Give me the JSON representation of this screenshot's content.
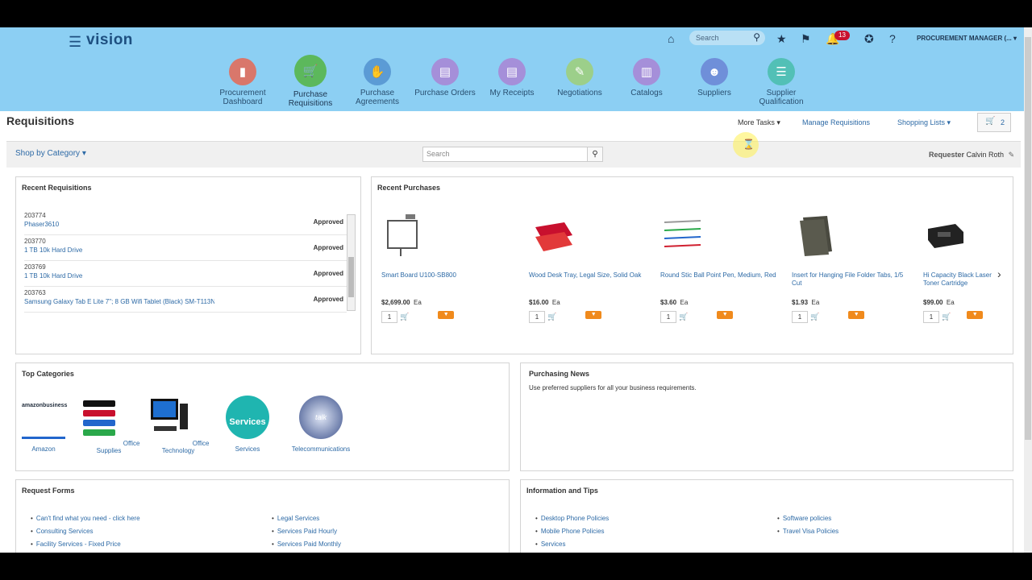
{
  "header": {
    "logo": "vision",
    "search_placeholder": "Search",
    "notifications_count": "13",
    "user": "PROCUREMENT MANAGER (...",
    "colors": {
      "bar": "#8ccff3",
      "badge": "#c8102e"
    }
  },
  "nav": [
    {
      "label": "Procurement Dashboard",
      "color": "#d9776b",
      "icon": "chart-icon"
    },
    {
      "label": "Purchase Requisitions",
      "color": "#5cb85c",
      "icon": "cart-icon"
    },
    {
      "label": "Purchase Agreements",
      "color": "#5b9bd5",
      "icon": "handshake-icon"
    },
    {
      "label": "Purchase Orders",
      "color": "#a58fd9",
      "icon": "document-icon"
    },
    {
      "label": "My Receipts",
      "color": "#a58fd9",
      "icon": "receipt-icon"
    },
    {
      "label": "Negotiations",
      "color": "#9ccf8a",
      "icon": "negotiation-icon"
    },
    {
      "label": "Catalogs",
      "color": "#a58fd9",
      "icon": "catalog-icon"
    },
    {
      "label": "Suppliers",
      "color": "#6f8fd9",
      "icon": "people-icon"
    },
    {
      "label": "Supplier Qualification",
      "color": "#52c0b6",
      "icon": "checklist-icon"
    }
  ],
  "page": {
    "title": "Requisitions",
    "more_tasks": "More Tasks",
    "manage": "Manage Requisitions",
    "shopping_lists": "Shopping Lists",
    "cart_count": "2"
  },
  "toolbar": {
    "shop_by_category": "Shop by Category",
    "search_placeholder": "Search",
    "requester_label": "Requester",
    "requester_value": "Calvin Roth"
  },
  "recent_requisitions": {
    "title": "Recent Requisitions",
    "items": [
      {
        "num": "203774",
        "desc": "Phaser3610",
        "status": "Approved"
      },
      {
        "num": "203770",
        "desc": "1 TB 10k Hard Drive",
        "status": "Approved"
      },
      {
        "num": "203769",
        "desc": "1 TB 10k Hard Drive",
        "status": "Approved"
      },
      {
        "num": "203763",
        "desc": "Samsung Galaxy Tab E Lite 7\"; 8 GB Wifi Tablet (Black) SM-T113N",
        "status": "Approved"
      }
    ]
  },
  "recent_purchases": {
    "title": "Recent Purchases",
    "items": [
      {
        "name": "Smart Board U100-SB800",
        "price": "$2,699.00",
        "uom": "Ea",
        "qty": "1"
      },
      {
        "name": "Wood Desk Tray, Legal Size, Solid Oak",
        "price": "$16.00",
        "uom": "Ea",
        "qty": "1"
      },
      {
        "name": "Round Stic Ball Point Pen, Medium, Red",
        "price": "$3.60",
        "uom": "Ea",
        "qty": "1"
      },
      {
        "name": "Insert for Hanging File Folder Tabs, 1/5 Cut",
        "price": "$1.93",
        "uom": "Ea",
        "qty": "1"
      },
      {
        "name": "Hi Capacity Black Laser Toner Cartridge",
        "price": "$99.00",
        "uom": "Ea",
        "qty": "1"
      }
    ]
  },
  "top_categories": {
    "title": "Top Categories",
    "items": [
      {
        "label": "Amazon",
        "img_text": "amazonbusiness"
      },
      {
        "label": "Office Supplies"
      },
      {
        "label": "Office Technology"
      },
      {
        "label": "Services",
        "img_text": "Services"
      },
      {
        "label": "Telecommunications",
        "img_text": "talk"
      }
    ]
  },
  "purchasing_news": {
    "title": "Purchasing News",
    "text": "Use preferred suppliers for all your business requirements."
  },
  "request_forms": {
    "title": "Request Forms",
    "left": [
      "Can't find what you need - click here",
      "Consulting Services",
      "Facility Services - Fixed Price"
    ],
    "right": [
      "Legal Services",
      "Services Paid Hourly",
      "Services Paid Monthly"
    ]
  },
  "info_tips": {
    "title": "Information and Tips",
    "left": [
      "Desktop Phone Policies",
      "Mobile Phone Policies",
      "Services"
    ],
    "right": [
      "Software policies",
      "Travel Visa Policies"
    ]
  }
}
